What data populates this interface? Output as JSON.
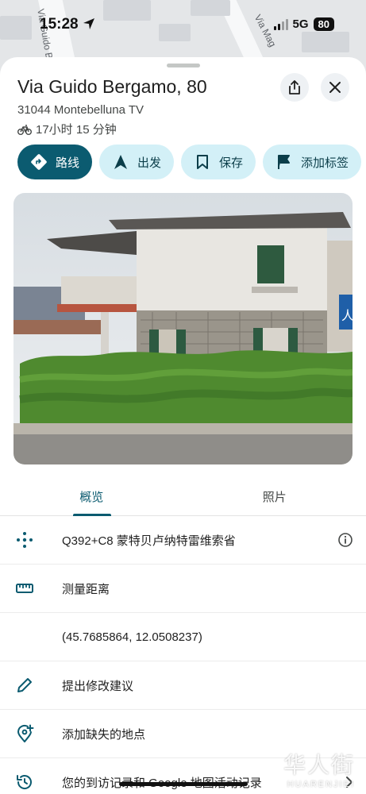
{
  "status_bar": {
    "time": "15:28",
    "network": "5G",
    "battery": "80"
  },
  "map": {
    "street_label_left": "Via Guido Berg",
    "street_label_right": "Via Mag"
  },
  "place": {
    "title": "Via Guido Bergamo, 80",
    "address": "31044 Montebelluna TV",
    "travel_time": "17小时 15 分钟"
  },
  "header_icons": {
    "share": "share-icon",
    "close": "close-icon"
  },
  "actions": [
    {
      "label": "路线",
      "icon": "directions-icon"
    },
    {
      "label": "出发",
      "icon": "navigation-arrow-icon"
    },
    {
      "label": "保存",
      "icon": "bookmark-icon"
    },
    {
      "label": "添加标签",
      "icon": "flag-icon"
    }
  ],
  "tabs": [
    {
      "label": "概览",
      "active": true
    },
    {
      "label": "照片",
      "active": false
    }
  ],
  "details": [
    {
      "icon": "plus-code-icon",
      "text": "Q392+C8 蒙特贝卢纳特雷维索省",
      "end_icon": "info-icon"
    },
    {
      "icon": "ruler-icon",
      "text": "测量距离"
    },
    {
      "icon": "",
      "text": "(45.7685864, 12.0508237)"
    },
    {
      "icon": "pencil-icon",
      "text": "提出修改建议"
    },
    {
      "icon": "add-place-icon",
      "text": "添加缺失的地点"
    },
    {
      "icon": "history-icon",
      "text": "您的到访记录和 Google 地图活动记录",
      "end_icon": "chevron-right-icon"
    }
  ],
  "watermark": {
    "cn": "华人街",
    "en": "HUARENJIEI"
  },
  "colors": {
    "primary": "#0b5b70",
    "chip_bg": "#d3f0f7",
    "sheet_bg": "#ffffff"
  }
}
